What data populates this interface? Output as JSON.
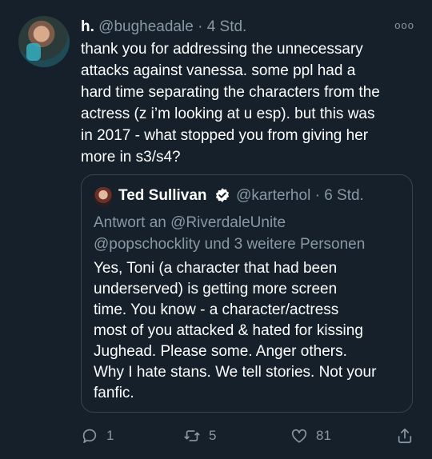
{
  "tweet": {
    "display_name": "h.",
    "handle": "@bugheadale",
    "separator": "·",
    "time": "4 Std.",
    "more_icon": "ooo",
    "body_lines": [
      "thank you for addressing the unnecessary",
      "attacks against vanessa. some ppl had a",
      "hard time separating the characters from the",
      "actress (z i’m looking at u esp). but this was",
      "in 2017 - what stopped you from giving her",
      "more in s3/s4?"
    ]
  },
  "quote": {
    "display_name": "Ted Sullivan",
    "handle": "@karterhol",
    "separator": "·",
    "time": "6 Std.",
    "reply_lines": [
      "Antwort an @RiverdaleUnite",
      "@popschocklity und 3 weitere Personen"
    ],
    "body_lines": [
      "Yes, Toni (a character that had been",
      "underserved) is getting more screen",
      "time. You know - a character/actress",
      "most of you attacked & hated for kissing",
      "Jughead. Please some. Anger others.",
      "Why I hate stans. We tell stories. Not your",
      "fanfic."
    ]
  },
  "actions": {
    "reply_count": "1",
    "retweet_count": "5",
    "like_count": "81",
    "icons": [
      "reply-icon",
      "retweet-icon",
      "like-icon",
      "share-icon"
    ]
  },
  "colors": {
    "background": "#15202b",
    "text": "#ffffff",
    "muted": "#8899a6",
    "border": "#38444d"
  }
}
